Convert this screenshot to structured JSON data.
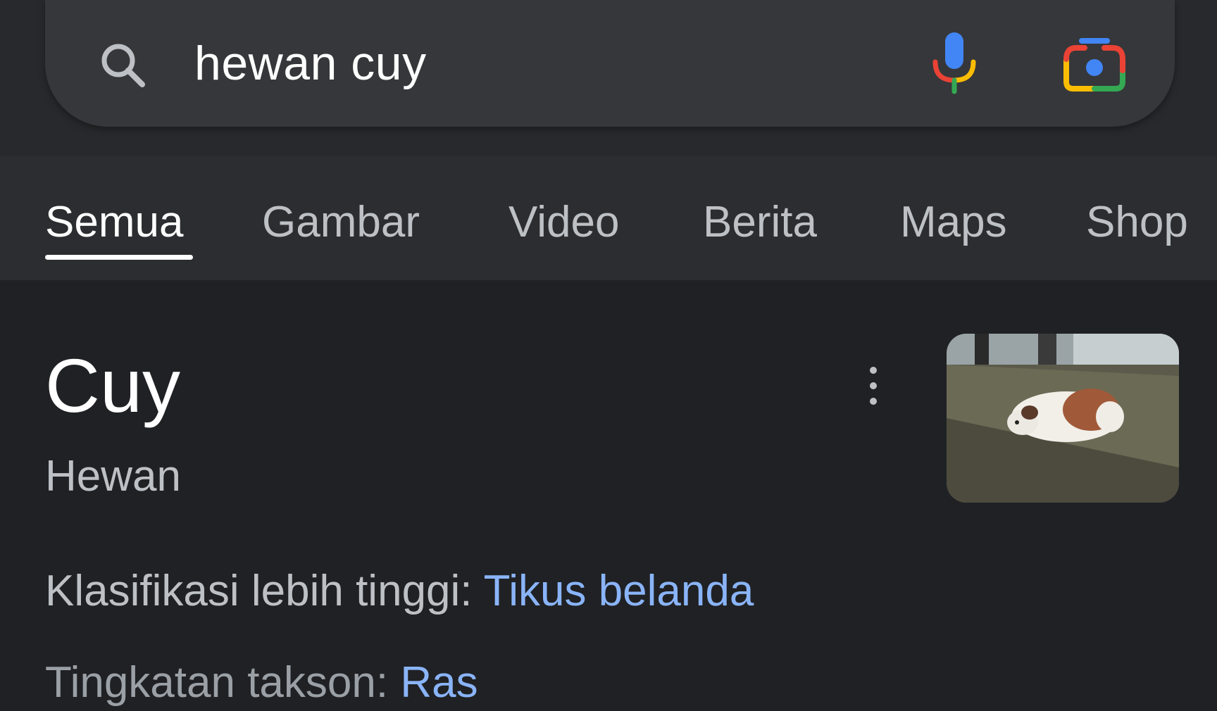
{
  "search": {
    "query": "hewan cuy",
    "icons": {
      "search": "search-icon",
      "voice": "microphone-icon",
      "lens": "camera-lens-icon"
    }
  },
  "tabs": [
    {
      "label": "Semua",
      "active": true
    },
    {
      "label": "Gambar"
    },
    {
      "label": "Video"
    },
    {
      "label": "Berita"
    },
    {
      "label": "Maps"
    },
    {
      "label": "Shop"
    }
  ],
  "knowledge_panel": {
    "title": "Cuy",
    "subtitle": "Hewan",
    "facts": [
      {
        "label": "Klasifikasi lebih tinggi:",
        "value": "Tikus belanda"
      },
      {
        "label": "Tingkatan takson:",
        "value": "Ras"
      }
    ]
  },
  "colors": {
    "background": "#202124",
    "link": "#8ab4f8",
    "google_blue": "#4285f4",
    "google_red": "#ea4335",
    "google_yellow": "#fbbc04",
    "google_green": "#34a853"
  }
}
